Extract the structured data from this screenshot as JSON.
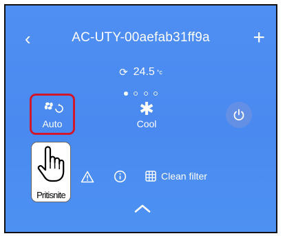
{
  "header": {
    "back_icon": "chevron-left-icon",
    "title": "AC-UTY-00aefab31ff9a",
    "add_icon": "plus-icon"
  },
  "status": {
    "refresh_icon": "refresh-icon",
    "temperature": "24.5",
    "unit": "°c"
  },
  "pager": {
    "count": 4,
    "active": 0
  },
  "modes": [
    {
      "label": "Auto",
      "icon": "fan-auto-icon",
      "highlighted": true
    },
    {
      "label": "Cool",
      "icon": "snowflake-icon"
    }
  ],
  "power_icon": "power-icon",
  "cursor_overlay": {
    "label": "Pritisnite",
    "icon": "hand-pointer-icon"
  },
  "actions": {
    "warning_icon": "warning-icon",
    "info_icon": "info-icon",
    "filter_icon": "filter-grid-icon",
    "filter_label": "Clean filter"
  },
  "expand_icon": "chevron-up-icon",
  "colors": {
    "background": "#4f8ff3",
    "highlight": "#d1172c",
    "text": "#ffffff"
  }
}
